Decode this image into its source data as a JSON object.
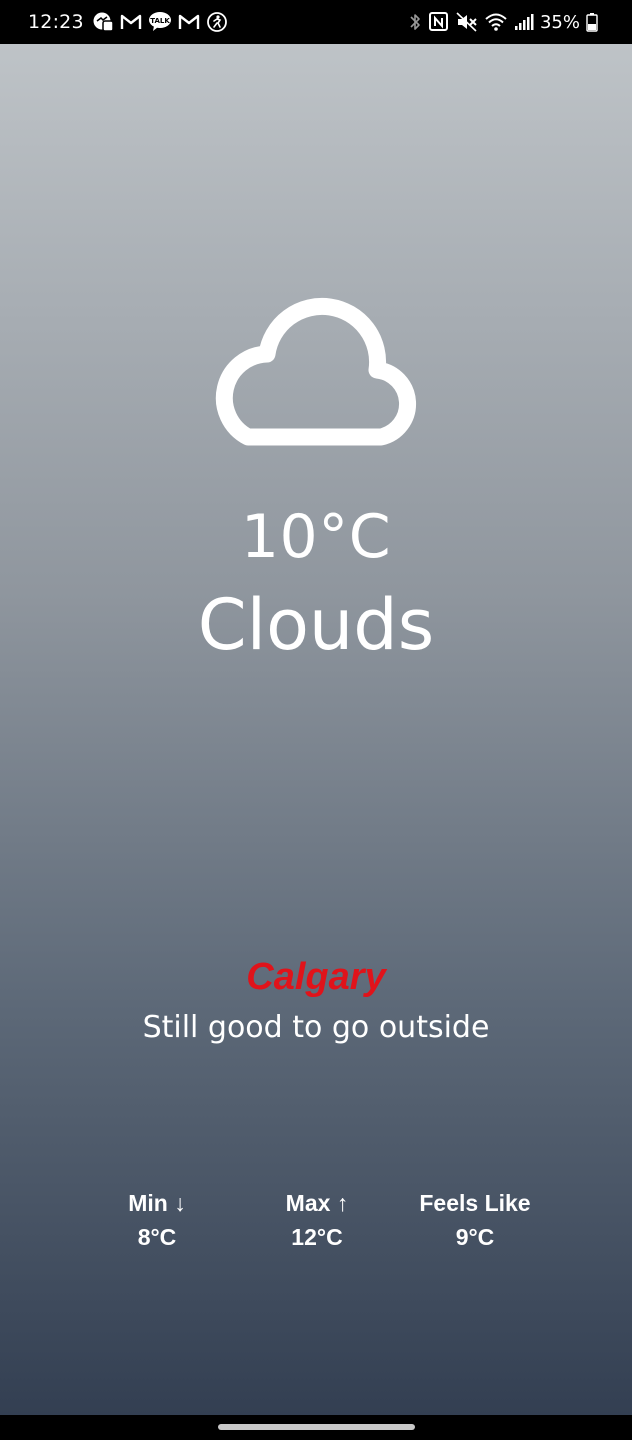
{
  "status_bar": {
    "time": "12:23",
    "left_icons": [
      "messenger-icon",
      "gmail-icon",
      "kakaotalk-icon",
      "gmail-icon",
      "accessibility-icon"
    ],
    "right_icons": [
      "bluetooth-icon",
      "nfc-icon",
      "mute-icon",
      "wifi-icon",
      "signal-icon",
      "battery-icon"
    ],
    "battery_percent": "35%"
  },
  "weather": {
    "icon": "cloud-icon",
    "temperature": "10°C",
    "condition": "Clouds",
    "city": "Calgary",
    "message": "Still good to go outside"
  },
  "stats": {
    "min_label": "Min ↓",
    "min_value": "8°C",
    "max_label": "Max ↑",
    "max_value": "12°C",
    "feels_label": "Feels Like",
    "feels_value": "9°C"
  },
  "colors": {
    "gradient_top": "#bec3c7",
    "gradient_bottom": "#333f52",
    "city": "#e0131a",
    "text": "#ffffff"
  }
}
